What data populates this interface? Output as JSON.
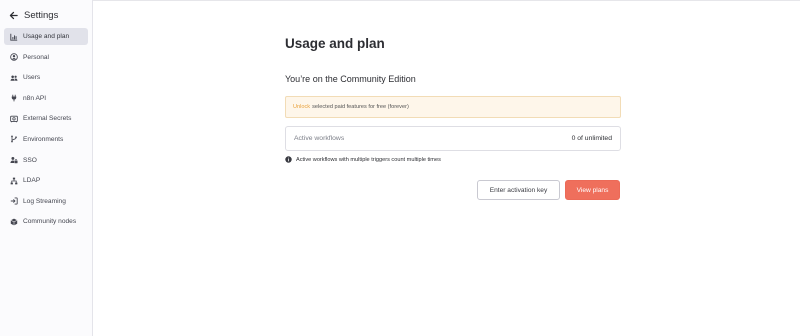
{
  "sidebar": {
    "title": "Settings",
    "back_icon": "arrow-left-icon",
    "items": [
      {
        "label": "Usage and plan",
        "icon": "bar-chart-icon",
        "active": true
      },
      {
        "label": "Personal",
        "icon": "user-circle-icon",
        "active": false
      },
      {
        "label": "Users",
        "icon": "users-icon",
        "active": false
      },
      {
        "label": "n8n API",
        "icon": "plug-icon",
        "active": false
      },
      {
        "label": "External Secrets",
        "icon": "vault-icon",
        "active": false
      },
      {
        "label": "Environments",
        "icon": "code-branch-icon",
        "active": false
      },
      {
        "label": "SSO",
        "icon": "user-lock-icon",
        "active": false
      },
      {
        "label": "LDAP",
        "icon": "network-icon",
        "active": false
      },
      {
        "label": "Log Streaming",
        "icon": "sign-in-icon",
        "active": false
      },
      {
        "label": "Community nodes",
        "icon": "cube-icon",
        "active": false
      }
    ]
  },
  "main": {
    "title": "Usage and plan",
    "edition_text": "You’re on the Community Edition",
    "notice": {
      "link_text": "Unlock",
      "text": "selected paid features for free (forever)"
    },
    "usage": {
      "label": "Active workflows",
      "value": "0 of unlimited"
    },
    "info_text": "Active workflows with multiple triggers count multiple times",
    "buttons": {
      "activation_key": "Enter activation key",
      "view_plans": "View plans"
    }
  },
  "colors": {
    "accent": "#ef6f5c",
    "notice_bg": "#fef6ea",
    "notice_link": "#e8a23d",
    "active_item_bg": "#e1e2ea"
  }
}
